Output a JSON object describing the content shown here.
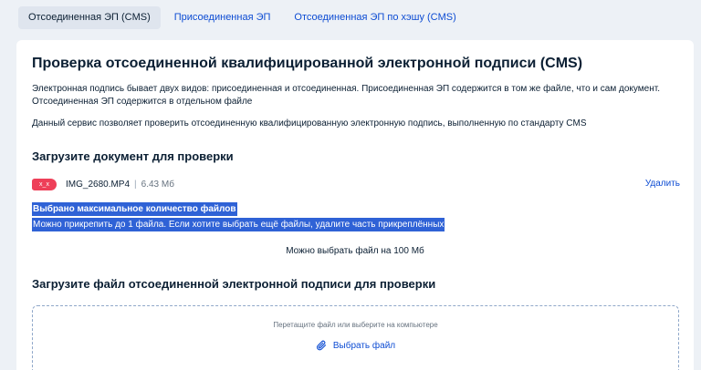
{
  "tabs": [
    {
      "label": "Отсоединенная ЭП (CMS)",
      "active": true
    },
    {
      "label": "Присоединенная ЭП",
      "active": false
    },
    {
      "label": "Отсоединенная ЭП по хэшу (CMS)",
      "active": false
    }
  ],
  "main": {
    "title": "Проверка отсоединенной квалифицированной электронной подписи (CMS)",
    "description_1": "Электронная подпись бывает двух видов: присоединенная и отсоединенная. Присоединенная ЭП содержится в том же файле, что и сам документ. Отсоединенная ЭП содержится в отдельном файле",
    "description_2": "Данный сервис позволяет проверить отсоединенную квалифицированную электронную подпись, выполненную по стандарту CMS"
  },
  "document_upload": {
    "heading": "Загрузите документ для проверки",
    "file": {
      "icon_text": "x_x",
      "name": "IMG_2680.MP4",
      "separator": "|",
      "size": "6.43 Мб"
    },
    "delete_label": "Удалить",
    "limit_title": "Выбрано максимальное количество файлов",
    "limit_message": "Можно прикрепить до 1 файла. Если хотите выбрать ещё файлы, удалите часть прикреплённых",
    "max_size_note": "Можно выбрать файл на 100 Мб"
  },
  "signature_upload": {
    "heading": "Загрузите файл отсоединенной электронной подписи для проверки",
    "dropzone_hint": "Перетащите файл или выберите на компьютере",
    "choose_label": "Выбрать файл"
  },
  "colors": {
    "accent": "#0d4cd3",
    "background": "#edf1f6",
    "file_icon": "#ee3f58",
    "selection": "#2f62d6"
  }
}
